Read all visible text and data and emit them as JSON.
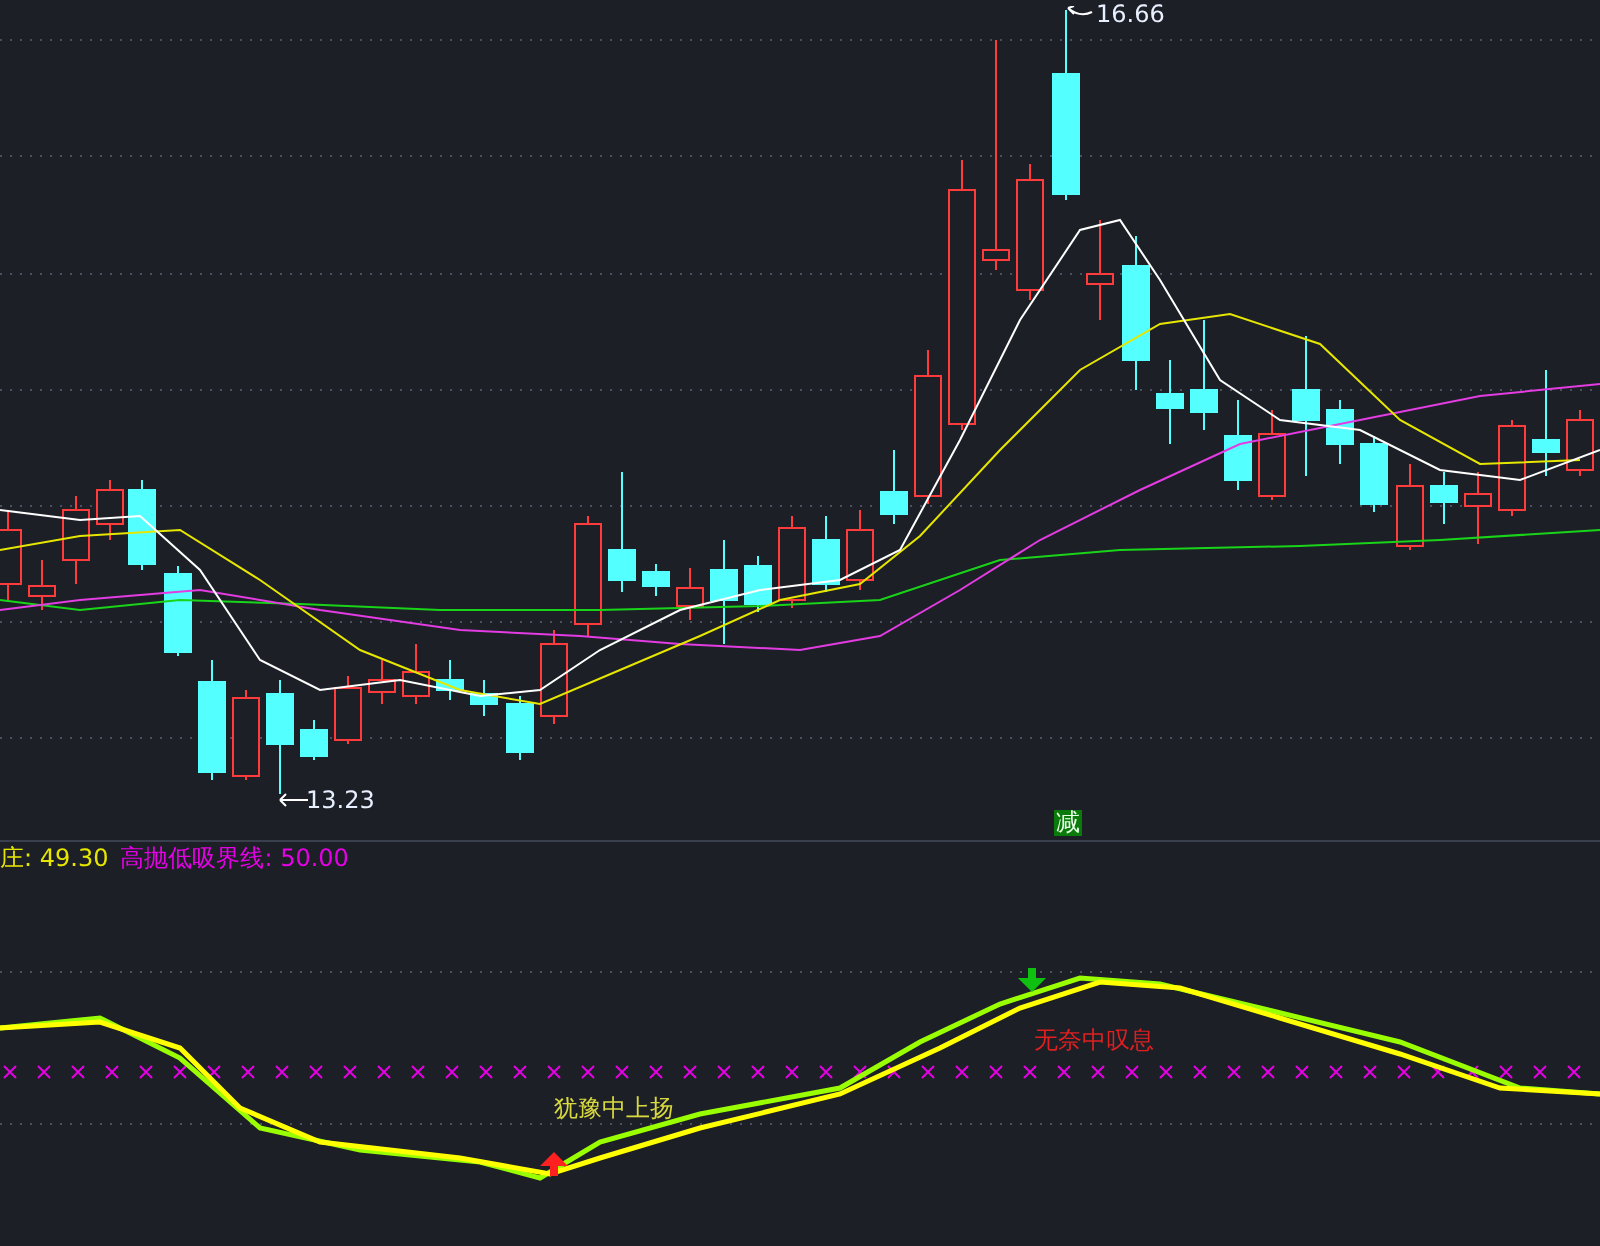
{
  "price_chart": {
    "high_label": "16.66",
    "low_label": "13.23",
    "signal": {
      "text": "减",
      "kind": "sell"
    }
  },
  "indicator": {
    "legend": [
      {
        "label": "庄:",
        "value": "49.30",
        "color": "#e6e600"
      },
      {
        "label": "高抛低吸界线:",
        "value": "50.00",
        "color": "#e600e6"
      }
    ],
    "annotations": [
      {
        "text": "犹豫中上扬",
        "kind": "rise"
      },
      {
        "text": "无奈中叹息",
        "kind": "fall"
      }
    ]
  }
}
